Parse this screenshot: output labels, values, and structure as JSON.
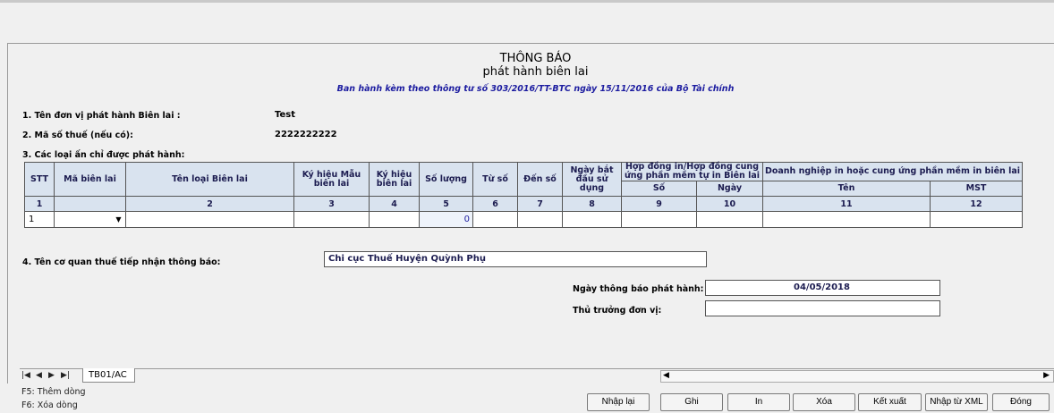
{
  "header": {
    "title_line1": "THÔNG BÁO",
    "title_line2": "phát hành biên lai",
    "subtitle": "Ban hành kèm theo thông tư số 303/2016/TT-BTC ngày 15/11/2016 của Bộ Tài chính"
  },
  "fields": {
    "unit_name_label": "1. Tên đơn vị phát hành Biên lai :",
    "unit_name_value": "Test",
    "tax_code_label": "2. Mã số thuế (nếu có):",
    "tax_code_value": "2222222222",
    "receipt_types_label": "3. Các loại ấn chỉ được phát hành:",
    "tax_office_label": "4. Tên cơ quan thuế tiếp nhận thông báo:",
    "tax_office_value": "Chi cục Thuế Huyện Quỳnh Phụ",
    "issue_date_label": "Ngày thông báo phát hành:",
    "issue_date_value": "04/05/2018",
    "head_label": "Thủ trưởng đơn vị:",
    "head_value": ""
  },
  "table": {
    "headers": {
      "stt": "STT",
      "ma_bien_lai": "Mã biên lai",
      "ten_loai": "Tên loại Biên lai",
      "ky_hieu_mau": "Ký hiệu Mẫu biên lai",
      "ky_hieu": "Ký hiệu biên lai",
      "so_luong": "Số lượng",
      "tu_so": "Từ số",
      "den_so": "Đến số",
      "ngay_bat_dau": "Ngày bắt đầu sử dụng",
      "hop_dong": "Hợp đồng in/Hợp đồng cung ứng phần mềm tự in Biên lai",
      "hd_so": "Số",
      "hd_ngay": "Ngày",
      "doanh_nghiep": "Doanh nghiệp in hoặc cung ứng phần mềm in biên lai",
      "dn_ten": "Tên",
      "dn_mst": "MST"
    },
    "column_numbers": [
      "1",
      "2",
      "3",
      "4",
      "5",
      "6",
      "7",
      "8",
      "9",
      "10",
      "11",
      "12"
    ],
    "rows": [
      {
        "stt": "1",
        "ma_bien_lai": "",
        "ten_loai": "",
        "ky_hieu_mau": "",
        "ky_hieu": "",
        "so_luong": "0",
        "tu_so": "",
        "den_so": "",
        "ngay_bat_dau": "",
        "hd_so": "",
        "hd_ngay": "",
        "dn_ten": "",
        "dn_mst": ""
      }
    ]
  },
  "sheet_tabs": {
    "active": "TB01/AC"
  },
  "hints": {
    "f5": "F5: Thêm dòng",
    "f6": "F6: Xóa dòng"
  },
  "buttons": {
    "reset": "Nhập lại",
    "save": "Ghi",
    "print": "In",
    "delete": "Xóa",
    "export": "Kết xuất",
    "import_xml": "Nhập từ XML",
    "close": "Đóng"
  },
  "icons": {
    "dropdown": "chevron-down-icon",
    "nav_first": "first-sheet-icon",
    "nav_prev": "prev-sheet-icon",
    "nav_next": "next-sheet-icon",
    "nav_last": "last-sheet-icon"
  }
}
